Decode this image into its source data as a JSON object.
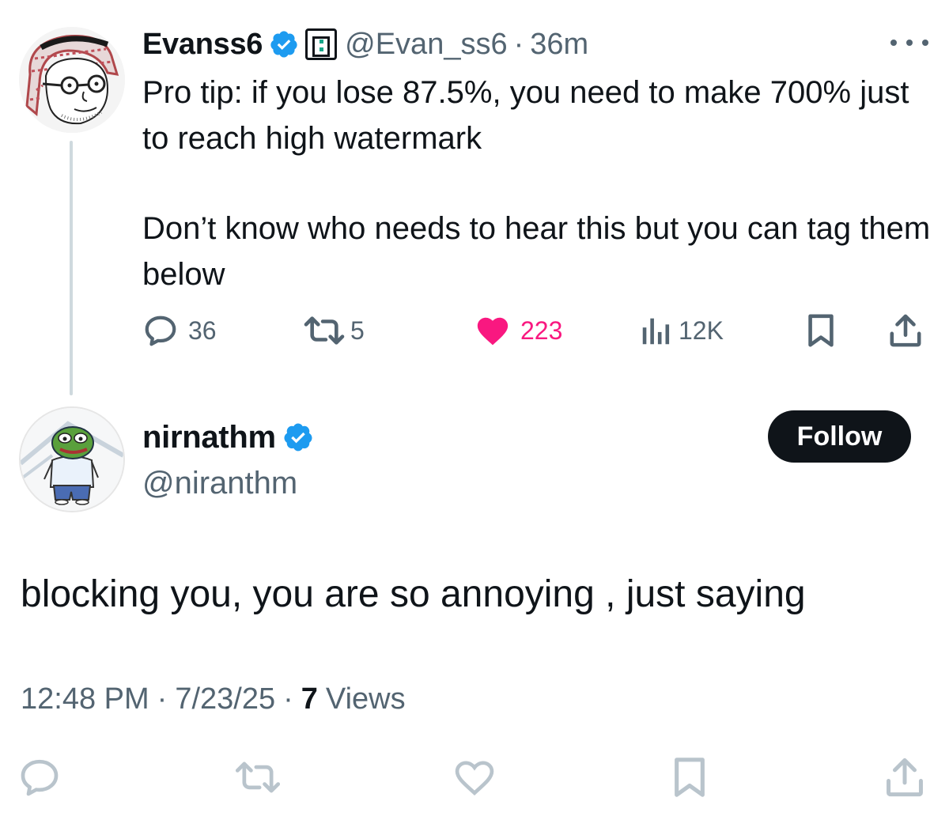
{
  "parent_tweet": {
    "display_name": "Evanss6",
    "handle": "@Evan_ss6",
    "time": "36m",
    "text_paragraph_1": "Pro tip: if you lose 87.5%, you need to make 700% just to reach high watermark",
    "text_paragraph_2": "Don’t know who needs to hear this but you can tag them below",
    "stats": {
      "replies": "36",
      "reposts": "5",
      "likes": "223",
      "views": "12K"
    }
  },
  "reply_tweet": {
    "display_name": "nirnathm",
    "handle": "@niranthm",
    "follow_label": "Follow",
    "text": "blocking you, you are so annoying , just saying",
    "timestamp": "12:48 PM",
    "date": "7/23/25",
    "views_count": "7",
    "views_label": "Views"
  },
  "colors": {
    "text_primary": "#0f1419",
    "text_secondary": "#536471",
    "verified_blue": "#1d9bf0",
    "like_pink": "#f91880",
    "icon_muted": "#b9c4cc"
  },
  "icons": {
    "verified": "verified-badge-icon",
    "affiliate": "affiliate-badge-icon",
    "more": "more-icon",
    "reply": "reply-icon",
    "repost": "repost-icon",
    "like": "heart-icon",
    "views": "views-icon",
    "bookmark": "bookmark-icon",
    "share": "share-icon"
  }
}
